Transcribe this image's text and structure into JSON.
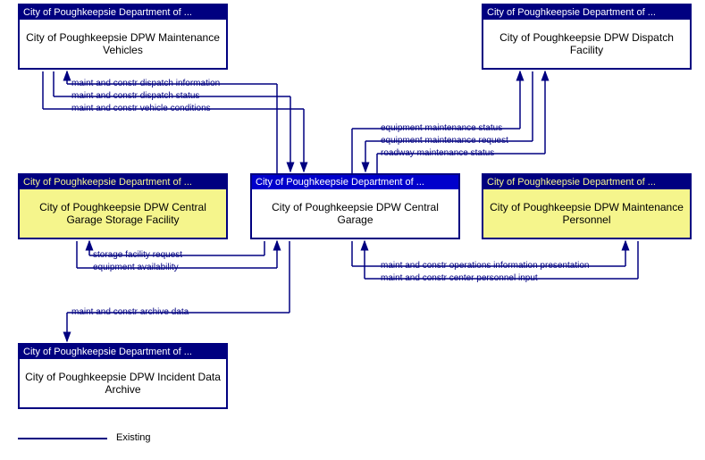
{
  "nodes": {
    "vehicles": {
      "header": "City of Poughkeepsie Department of ...",
      "body": "City of Poughkeepsie DPW Maintenance Vehicles"
    },
    "dispatch": {
      "header": "City of Poughkeepsie Department of ...",
      "body": "City of Poughkeepsie DPW Dispatch Facility"
    },
    "storage": {
      "header": "City of Poughkeepsie Department of ...",
      "body": "City of Poughkeepsie DPW Central Garage Storage Facility"
    },
    "garage": {
      "header": "City of Poughkeepsie Department of ...",
      "body": "City of Poughkeepsie DPW Central Garage"
    },
    "personnel": {
      "header": "City of Poughkeepsie Department of ...",
      "body": "City of Poughkeepsie DPW Maintenance Personnel"
    },
    "archive": {
      "header": "City of Poughkeepsie Department of ...",
      "body": "City of Poughkeepsie DPW Incident Data Archive"
    }
  },
  "flows": {
    "f1": "maint and constr dispatch information",
    "f2": "maint and constr dispatch status",
    "f3": "maint and constr vehicle conditions",
    "f4": "equipment maintenance status",
    "f5": "equipment maintenance request",
    "f6": "roadway maintenance status",
    "f7": "storage facility request",
    "f8": "equipment availability",
    "f9": "maint and constr archive data",
    "f10": "maint and constr operations information presentation",
    "f11": "maint and constr center personnel input"
  },
  "legend": {
    "existing": "Existing"
  }
}
